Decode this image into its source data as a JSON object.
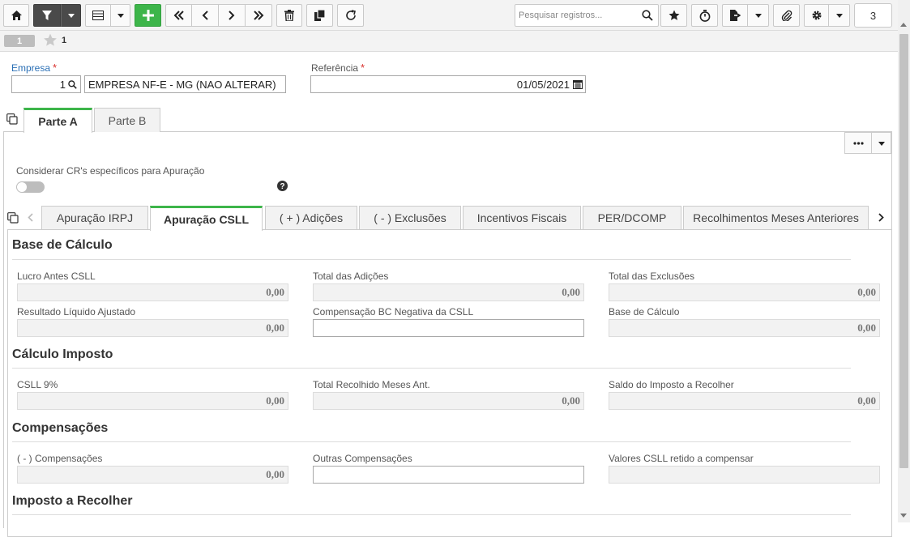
{
  "toolbar": {
    "search_placeholder": "Pesquisar registros...",
    "counter": "3",
    "icons": [
      "home-icon",
      "filter-icon",
      "chevron-down-icon",
      "grid-icon",
      "plus-icon",
      "first-page-icon",
      "prev-icon",
      "next-icon",
      "last-page-icon",
      "trash-icon",
      "copy-icon",
      "refresh-icon",
      "search-icon",
      "star-icon",
      "timer-icon",
      "export-icon",
      "paperclip-icon",
      "gear-icon"
    ]
  },
  "subbar": {
    "page": "1",
    "favorites_count": "1"
  },
  "header": {
    "empresa_label": "Empresa",
    "empresa_code": "1",
    "empresa_name": "EMPRESA NF-E - MG (NAO ALTERAR)",
    "referencia_label": "Referência",
    "referencia_value": "01/05/2021",
    "required_mark": "*"
  },
  "main_tabs": [
    {
      "label": "Parte A",
      "active": true
    },
    {
      "label": "Parte B",
      "active": false
    }
  ],
  "toggle": {
    "label": "Considerar CR's específicos para Apuração",
    "on": false
  },
  "sub_tabs": [
    {
      "label": "Apuração IRPJ",
      "active": false
    },
    {
      "label": "Apuração CSLL",
      "active": true
    },
    {
      "label": "( + ) Adições",
      "active": false
    },
    {
      "label": "( - ) Exclusões",
      "active": false
    },
    {
      "label": "Incentivos Fiscais",
      "active": false
    },
    {
      "label": "PER/DCOMP",
      "active": false
    },
    {
      "label": "Recolhimentos Meses Anteriores",
      "active": false
    }
  ],
  "sections": {
    "base": {
      "title": "Base de Cálculo",
      "lucro_label": "Lucro Antes CSLL",
      "lucro_value": "0,00",
      "adicoes_label": "Total das Adições",
      "adicoes_value": "0,00",
      "exclusoes_label": "Total das Exclusões",
      "exclusoes_value": "0,00",
      "resultado_label": "Resultado Líquido Ajustado",
      "resultado_value": "0,00",
      "compensacao_label": "Compensação BC Negativa da CSLL",
      "compensacao_value": "",
      "base_label": "Base de Cálculo",
      "base_value": "0,00"
    },
    "calculo": {
      "title": "Cálculo Imposto",
      "csll_label": "CSLL 9%",
      "csll_value": "0,00",
      "recolhido_label": "Total Recolhido Meses Ant.",
      "recolhido_value": "0,00",
      "saldo_label": "Saldo do Imposto a Recolher",
      "saldo_value": "0,00"
    },
    "compensacoes": {
      "title": "Compensações",
      "comp_label": "( - ) Compensações",
      "comp_value": "0,00",
      "outras_label": "Outras Compensações",
      "outras_value": "",
      "retido_label": "Valores CSLL retido a compensar",
      "retido_value": ""
    },
    "imposto": {
      "title": "Imposto a Recolher"
    }
  },
  "colors": {
    "accent_green": "#3db54a",
    "label_blue": "#2a6fb5",
    "required_red": "#d9322f"
  }
}
